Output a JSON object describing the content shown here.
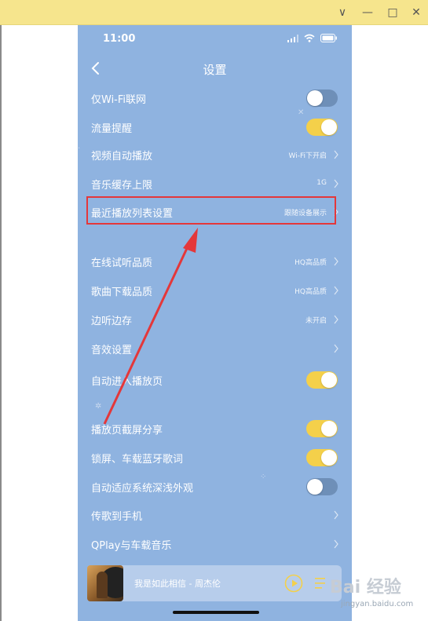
{
  "window": {
    "minimize_label": "∨",
    "restore_label": "—",
    "maximize_label": "□",
    "close_label": "✕"
  },
  "statusbar": {
    "time": "11:00"
  },
  "nav": {
    "title": "设置"
  },
  "rows": [
    {
      "label": "仅Wi-Fi联网",
      "toggle": "off"
    },
    {
      "label": "流量提醒",
      "toggle": "on"
    },
    {
      "label": "视频自动播放",
      "value": "Wi-Fi下开启"
    },
    {
      "label": "音乐缓存上限",
      "value": "1G"
    },
    {
      "label": "最近播放列表设置",
      "value": "跟随设备展示"
    },
    {
      "label": "在线试听品质",
      "value": "HQ高品质"
    },
    {
      "label": "歌曲下载品质",
      "value": "HQ高品质"
    },
    {
      "label": "边听边存",
      "value": "未开启"
    },
    {
      "label": "音效设置"
    },
    {
      "label": "自动进入播放页",
      "toggle": "on"
    },
    {
      "label": "播放页截屏分享",
      "toggle": "on"
    },
    {
      "label": "锁屏、车载蓝牙歌词",
      "toggle": "on"
    },
    {
      "label": "自动适应系统深浅外观",
      "toggle": "off"
    },
    {
      "label": "传歌到手机"
    },
    {
      "label": "QPlay与车载音乐"
    }
  ],
  "player": {
    "song": "我是如此相信 - 周杰伦"
  },
  "watermark": {
    "logo": "Bai  经验",
    "url": "jingyan.baidu.com"
  },
  "colors": {
    "background": "#8fb3e0",
    "toggle_on": "#f4d04a",
    "toggle_off": "#6e8fb8",
    "highlight": "#e4373a",
    "arrow": "#e4373a",
    "titlebar": "#f6e58d"
  },
  "icons": {
    "back": "chevron-left-icon",
    "chevron": "chevron-right-icon",
    "play": "play-circle-icon",
    "playlist": "playlist-icon"
  }
}
